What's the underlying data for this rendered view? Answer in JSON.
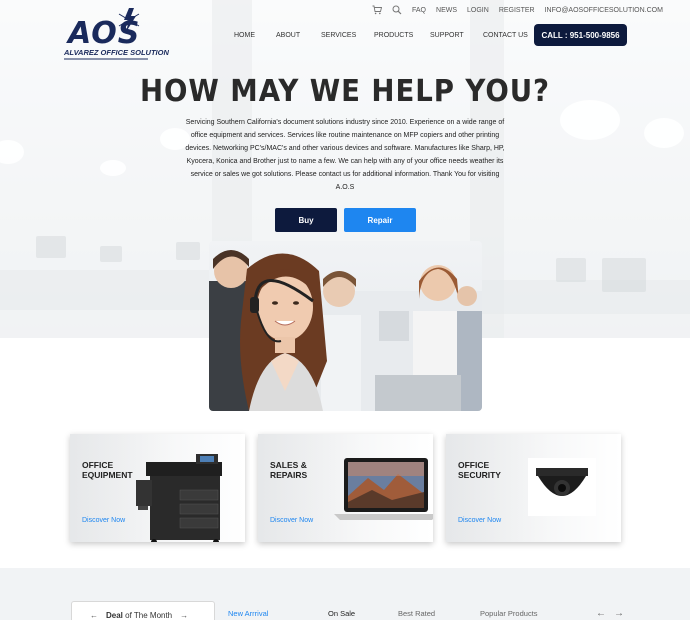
{
  "brand": {
    "logo_text": "AOS",
    "logo_subtitle": "ALVAREZ OFFICE SOLUTION",
    "color_primary": "#0d1a3d",
    "color_accent": "#1e86f0"
  },
  "topbar": {
    "cart_icon": "cart-icon",
    "search_icon": "search-icon",
    "links": [
      "FAQ",
      "NEWS",
      "LOGIN",
      "REGISTER"
    ],
    "email": "INFO@AOSOFFICESOLUTION.COM"
  },
  "nav": {
    "items": [
      "HOME",
      "ABOUT",
      "SERVICES",
      "PRODUCTS",
      "SUPPORT",
      "CONTACT US"
    ],
    "call_label": "CALL : 951-500-9856"
  },
  "hero": {
    "headline": "HOW MAY WE HELP YOU?",
    "intro": "Servicing Southern California's document solutions industry since 2010. Experience on a wide range of office equipment and services. Services like routine maintenance on MFP copiers and other printing devices. Networking PC's/MAC's and other various devices and software. Manufactures like Sharp, HP, Kyocera, Konica and Brother just to name a few. We can help with any of your office needs weather its service or sales we got solutions. Please contact us for additional information. Thank You for visiting A.O.S",
    "buy_label": "Buy",
    "repair_label": "Repair"
  },
  "categories": [
    {
      "line1": "OFFICE",
      "line2": "EQUIPMENT",
      "link": "Discover Now",
      "icon": "copier-image"
    },
    {
      "line1": "SALES &",
      "line2": "REPAIRS",
      "link": "Discover Now",
      "icon": "laptop-image"
    },
    {
      "line1": "OFFICE",
      "line2": "SECURITY",
      "link": "Discover Now",
      "icon": "security-camera-image"
    }
  ],
  "products": {
    "deal_prefix": "Deal",
    "deal_suffix": "of The Month",
    "tabs": [
      "New Arrrival",
      "On Sale",
      "Best Rated",
      "Popular Products"
    ],
    "prev": "←",
    "next": "→"
  }
}
